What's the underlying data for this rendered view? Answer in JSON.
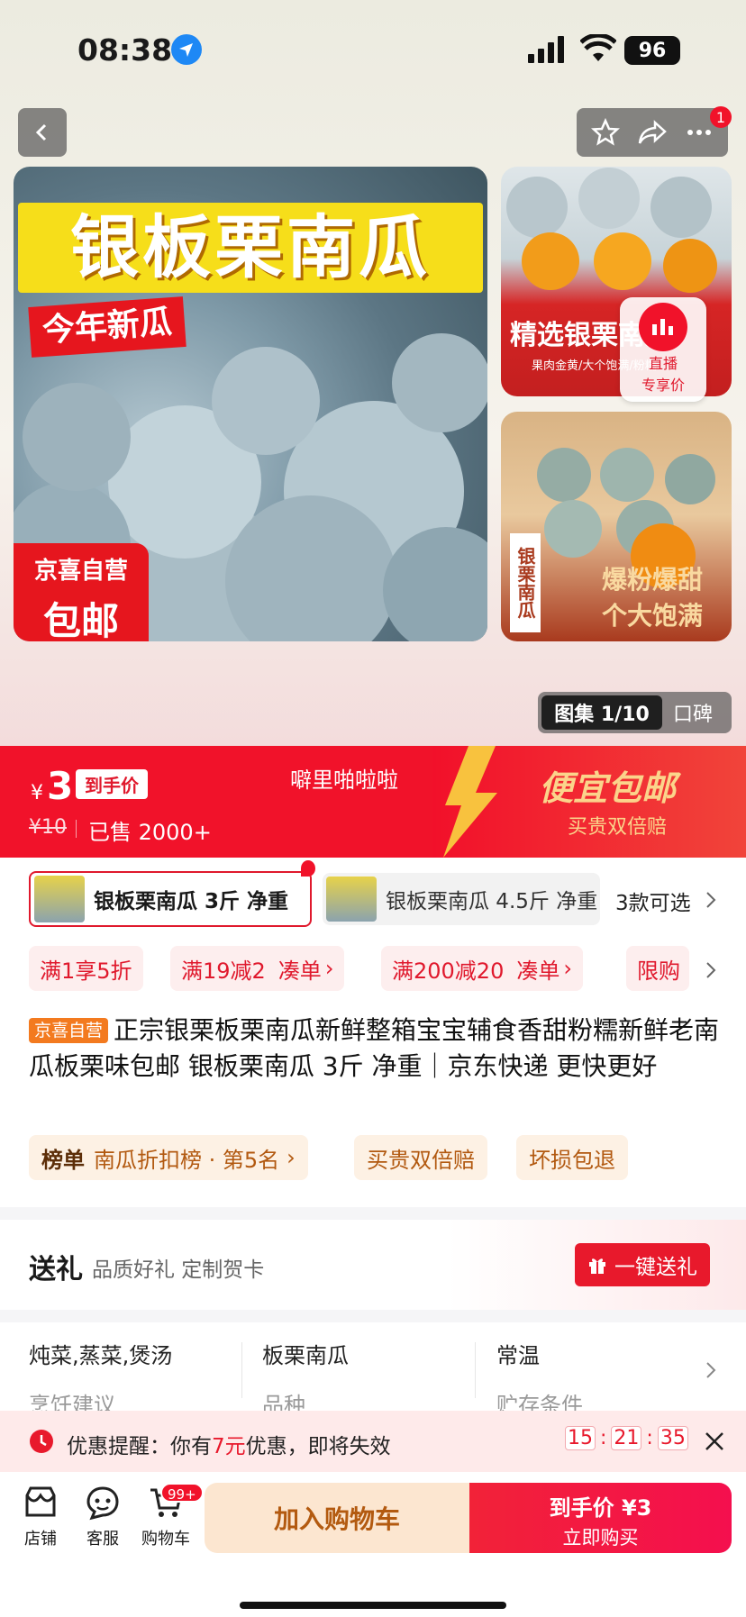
{
  "status": {
    "time": "08:38",
    "battery": "96"
  },
  "nav": {
    "back": "back",
    "badge": "1"
  },
  "gallery": {
    "main_title": "银板栗南瓜",
    "main_sub": "今年新瓜",
    "main_badge1": "京喜自营",
    "main_badge2": "包邮",
    "thumb1_text": "精选银栗南瓜",
    "thumb1_sub": "果肉金黄/大个饱满/粉糯",
    "live1": "直播",
    "live2": "专享价",
    "thumb2_text1": "爆粉爆甜",
    "thumb2_text2": "个大饱满",
    "thumb2_vert": "银栗南瓜",
    "counter": "图集 1/10",
    "reviews": "口碑"
  },
  "price": {
    "symbol": "¥",
    "value": "3",
    "tag": "到手价",
    "orig": "¥10",
    "sold": "已售 2000+",
    "shop_name": "噼里啪啦啦",
    "promo_title": "便宜包邮",
    "promo_sub": "买贵双倍赔"
  },
  "variants": [
    {
      "label": "银板栗南瓜 3斤 净重"
    },
    {
      "label": "银板栗南瓜 4.5斤 净重"
    }
  ],
  "variants_more": "3款可选",
  "coupons": [
    {
      "text": "满1享5折"
    },
    {
      "text": "满19减2",
      "action": "凑单"
    },
    {
      "text": "满200减20",
      "action": "凑单"
    },
    {
      "text": "限购"
    }
  ],
  "product": {
    "badge": "京喜自营",
    "title": "正宗银栗板栗南瓜新鲜整箱宝宝辅食香甜粉糯新鲜老南瓜板栗味包邮 银板栗南瓜 3斤 净重｜京东快递 更快更好"
  },
  "tags": {
    "rank_label": "榜单",
    "rank_text": "南瓜折扣榜 · 第5名",
    "t1": "买贵双倍赔",
    "t2": "坏损包退"
  },
  "gift": {
    "title": "送礼",
    "sub": "品质好礼 定制贺卡",
    "button": "一键送礼"
  },
  "attrs": [
    {
      "value": "炖菜,蒸菜,煲汤",
      "label": "烹饪建议"
    },
    {
      "value": "板栗南瓜",
      "label": "品种"
    },
    {
      "value": "常温",
      "label": "贮存条件"
    }
  ],
  "reminder": {
    "prefix": "优惠提醒：你有",
    "amount": "7元",
    "suffix": "优惠，即将失效",
    "h": "15",
    "m": "21",
    "s": "35"
  },
  "bottom": {
    "shop": "店铺",
    "service": "客服",
    "cart": "购物车",
    "cart_badge": "99+",
    "add_cart": "加入购物车",
    "buy_line1": "到手价 ¥3",
    "buy_line2": "立即购买"
  }
}
